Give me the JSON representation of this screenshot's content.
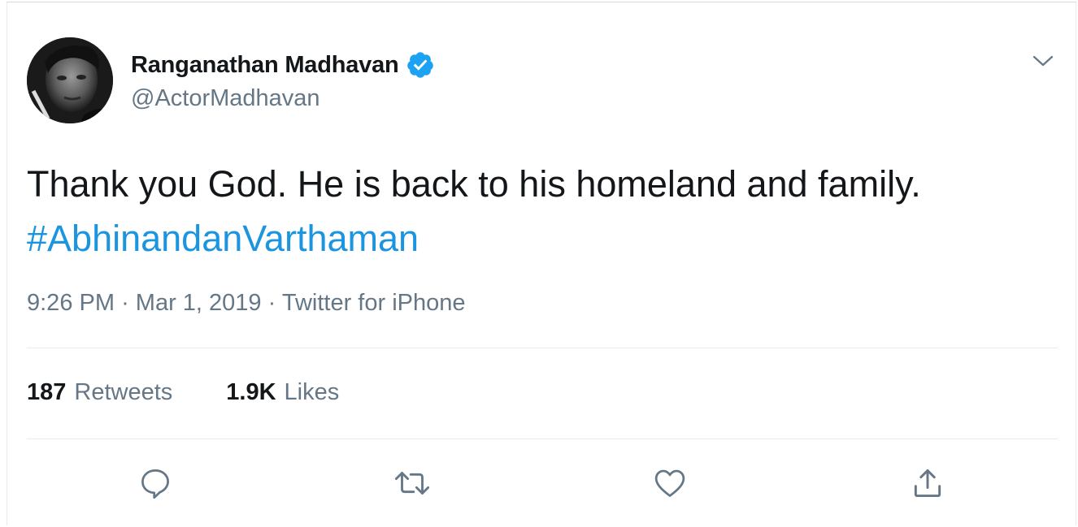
{
  "tweet": {
    "author": {
      "display_name": "Ranganathan Madhavan",
      "handle": "@ActorMadhavan",
      "verified": true,
      "avatar_icon": "profile-photo"
    },
    "text_line": "Thank you God. He is back to his homeland and family.",
    "hashtag": "#AbhinandanVarthaman",
    "meta": {
      "time": "9:26 PM",
      "separator": "·",
      "date": "Mar 1, 2019",
      "source": "Twitter for iPhone"
    },
    "stats": {
      "retweets_count": "187",
      "retweets_label": "Retweets",
      "likes_count": "1.9K",
      "likes_label": "Likes"
    },
    "actions": [
      "reply-icon",
      "retweet-icon",
      "like-icon",
      "share-icon"
    ],
    "menu_icon": "chevron-down-icon"
  },
  "colors": {
    "link": "#1b95e0",
    "text": "#14171a",
    "secondary": "#657786",
    "verified": "#1da1f2",
    "divider": "#e6ecf0"
  }
}
